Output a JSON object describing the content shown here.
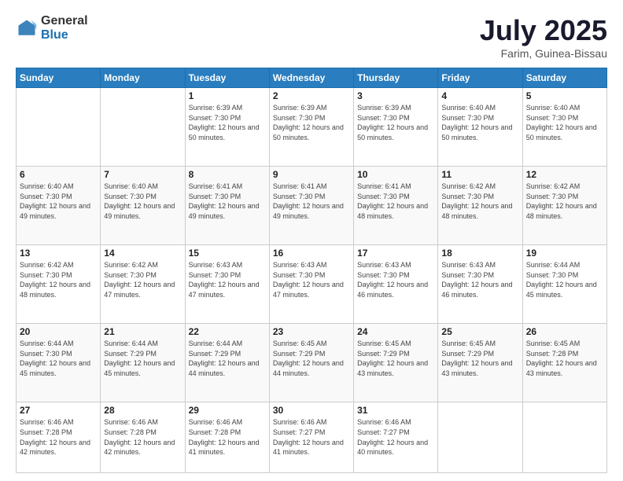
{
  "header": {
    "logo_general": "General",
    "logo_blue": "Blue",
    "month": "July 2025",
    "location": "Farim, Guinea-Bissau"
  },
  "days_of_week": [
    "Sunday",
    "Monday",
    "Tuesday",
    "Wednesday",
    "Thursday",
    "Friday",
    "Saturday"
  ],
  "weeks": [
    [
      {
        "day": "",
        "info": ""
      },
      {
        "day": "",
        "info": ""
      },
      {
        "day": "1",
        "info": "Sunrise: 6:39 AM\nSunset: 7:30 PM\nDaylight: 12 hours and 50 minutes."
      },
      {
        "day": "2",
        "info": "Sunrise: 6:39 AM\nSunset: 7:30 PM\nDaylight: 12 hours and 50 minutes."
      },
      {
        "day": "3",
        "info": "Sunrise: 6:39 AM\nSunset: 7:30 PM\nDaylight: 12 hours and 50 minutes."
      },
      {
        "day": "4",
        "info": "Sunrise: 6:40 AM\nSunset: 7:30 PM\nDaylight: 12 hours and 50 minutes."
      },
      {
        "day": "5",
        "info": "Sunrise: 6:40 AM\nSunset: 7:30 PM\nDaylight: 12 hours and 50 minutes."
      }
    ],
    [
      {
        "day": "6",
        "info": "Sunrise: 6:40 AM\nSunset: 7:30 PM\nDaylight: 12 hours and 49 minutes."
      },
      {
        "day": "7",
        "info": "Sunrise: 6:40 AM\nSunset: 7:30 PM\nDaylight: 12 hours and 49 minutes."
      },
      {
        "day": "8",
        "info": "Sunrise: 6:41 AM\nSunset: 7:30 PM\nDaylight: 12 hours and 49 minutes."
      },
      {
        "day": "9",
        "info": "Sunrise: 6:41 AM\nSunset: 7:30 PM\nDaylight: 12 hours and 49 minutes."
      },
      {
        "day": "10",
        "info": "Sunrise: 6:41 AM\nSunset: 7:30 PM\nDaylight: 12 hours and 48 minutes."
      },
      {
        "day": "11",
        "info": "Sunrise: 6:42 AM\nSunset: 7:30 PM\nDaylight: 12 hours and 48 minutes."
      },
      {
        "day": "12",
        "info": "Sunrise: 6:42 AM\nSunset: 7:30 PM\nDaylight: 12 hours and 48 minutes."
      }
    ],
    [
      {
        "day": "13",
        "info": "Sunrise: 6:42 AM\nSunset: 7:30 PM\nDaylight: 12 hours and 48 minutes."
      },
      {
        "day": "14",
        "info": "Sunrise: 6:42 AM\nSunset: 7:30 PM\nDaylight: 12 hours and 47 minutes."
      },
      {
        "day": "15",
        "info": "Sunrise: 6:43 AM\nSunset: 7:30 PM\nDaylight: 12 hours and 47 minutes."
      },
      {
        "day": "16",
        "info": "Sunrise: 6:43 AM\nSunset: 7:30 PM\nDaylight: 12 hours and 47 minutes."
      },
      {
        "day": "17",
        "info": "Sunrise: 6:43 AM\nSunset: 7:30 PM\nDaylight: 12 hours and 46 minutes."
      },
      {
        "day": "18",
        "info": "Sunrise: 6:43 AM\nSunset: 7:30 PM\nDaylight: 12 hours and 46 minutes."
      },
      {
        "day": "19",
        "info": "Sunrise: 6:44 AM\nSunset: 7:30 PM\nDaylight: 12 hours and 45 minutes."
      }
    ],
    [
      {
        "day": "20",
        "info": "Sunrise: 6:44 AM\nSunset: 7:30 PM\nDaylight: 12 hours and 45 minutes."
      },
      {
        "day": "21",
        "info": "Sunrise: 6:44 AM\nSunset: 7:29 PM\nDaylight: 12 hours and 45 minutes."
      },
      {
        "day": "22",
        "info": "Sunrise: 6:44 AM\nSunset: 7:29 PM\nDaylight: 12 hours and 44 minutes."
      },
      {
        "day": "23",
        "info": "Sunrise: 6:45 AM\nSunset: 7:29 PM\nDaylight: 12 hours and 44 minutes."
      },
      {
        "day": "24",
        "info": "Sunrise: 6:45 AM\nSunset: 7:29 PM\nDaylight: 12 hours and 43 minutes."
      },
      {
        "day": "25",
        "info": "Sunrise: 6:45 AM\nSunset: 7:29 PM\nDaylight: 12 hours and 43 minutes."
      },
      {
        "day": "26",
        "info": "Sunrise: 6:45 AM\nSunset: 7:28 PM\nDaylight: 12 hours and 43 minutes."
      }
    ],
    [
      {
        "day": "27",
        "info": "Sunrise: 6:46 AM\nSunset: 7:28 PM\nDaylight: 12 hours and 42 minutes."
      },
      {
        "day": "28",
        "info": "Sunrise: 6:46 AM\nSunset: 7:28 PM\nDaylight: 12 hours and 42 minutes."
      },
      {
        "day": "29",
        "info": "Sunrise: 6:46 AM\nSunset: 7:28 PM\nDaylight: 12 hours and 41 minutes."
      },
      {
        "day": "30",
        "info": "Sunrise: 6:46 AM\nSunset: 7:27 PM\nDaylight: 12 hours and 41 minutes."
      },
      {
        "day": "31",
        "info": "Sunrise: 6:46 AM\nSunset: 7:27 PM\nDaylight: 12 hours and 40 minutes."
      },
      {
        "day": "",
        "info": ""
      },
      {
        "day": "",
        "info": ""
      }
    ]
  ]
}
